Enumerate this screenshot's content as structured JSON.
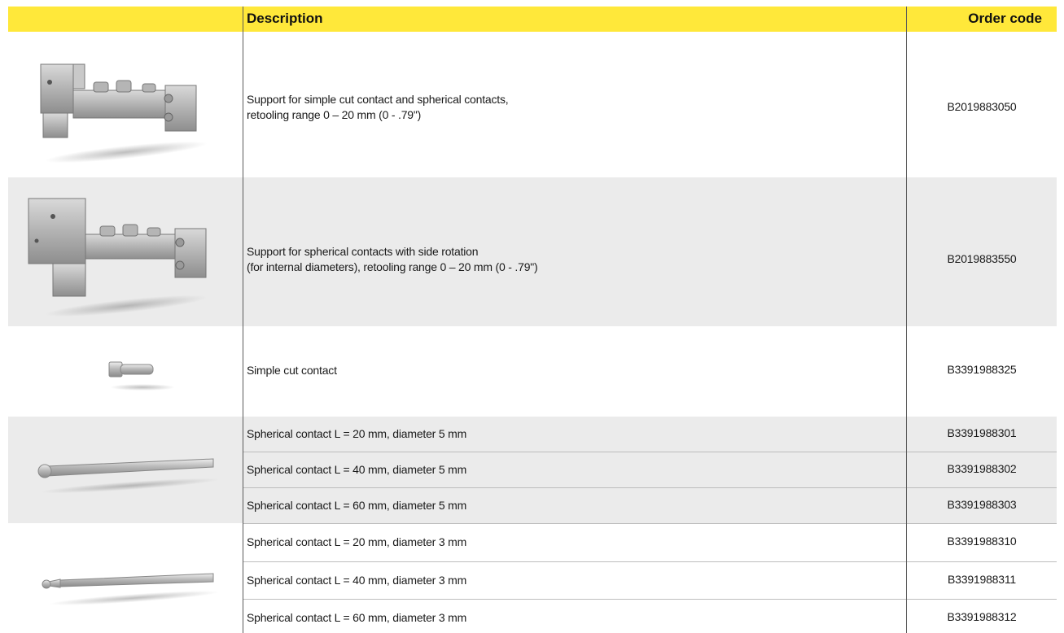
{
  "header": {
    "description_label": "Description",
    "order_code_label": "Order code",
    "accent_color": "#ffe83a"
  },
  "rows": [
    {
      "image": "support-bracket-image",
      "lines": [
        "Support for simple cut contact and spherical contacts,",
        "retooling range 0 – 20 mm (0 - .79\")"
      ],
      "code": "B2019883050"
    },
    {
      "image": "support-bracket-rotation-image",
      "lines": [
        "Support for spherical contacts with side rotation",
        "(for internal diameters), retooling range 0 – 20 mm (0 - .79\")"
      ],
      "code": "B2019883550"
    },
    {
      "image": "cut-contact-pin-image",
      "lines": [
        "Simple cut contact"
      ],
      "code": "B3391988325"
    }
  ],
  "group_5mm": {
    "image": "spherical-contact-5mm-image",
    "items": [
      {
        "text": "Spherical contact L = 20 mm, diameter 5 mm",
        "code": "B3391988301"
      },
      {
        "text": "Spherical contact L = 40 mm, diameter 5 mm",
        "code": "B3391988302"
      },
      {
        "text": "Spherical contact L = 60 mm, diameter 5 mm",
        "code": "B3391988303"
      }
    ]
  },
  "group_3mm": {
    "image": "spherical-contact-3mm-image",
    "items": [
      {
        "text": "Spherical contact L = 20 mm, diameter 3 mm",
        "code": "B3391988310"
      },
      {
        "text": "Spherical contact L = 40 mm, diameter 3 mm",
        "code": "B3391988311"
      },
      {
        "text": "Spherical contact L = 60 mm, diameter 3 mm",
        "code": "B3391988312"
      }
    ]
  }
}
